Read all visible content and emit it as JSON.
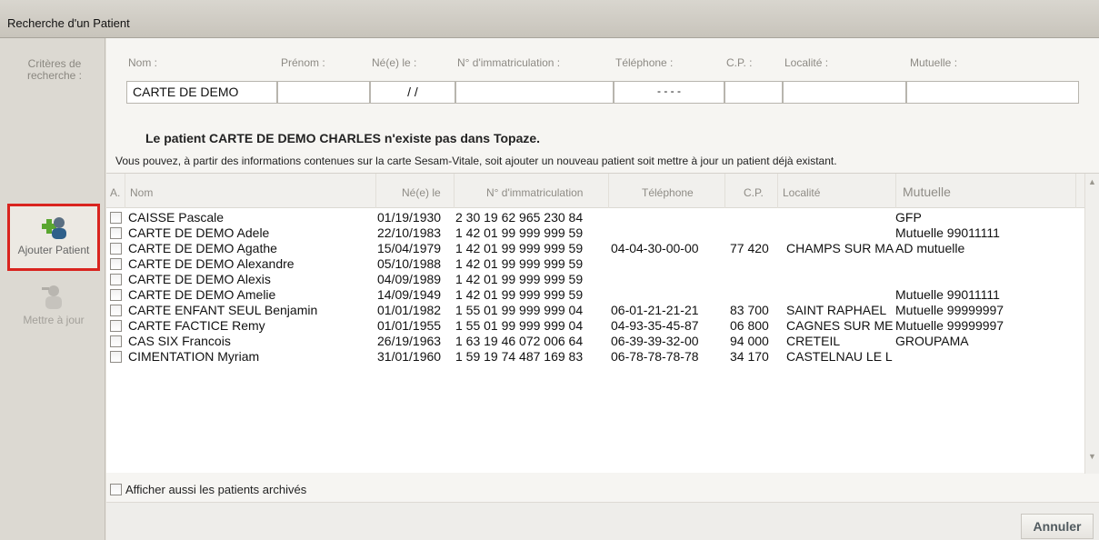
{
  "window": {
    "title": "Recherche d'un Patient"
  },
  "sidebar": {
    "criteria_label": "Critères de recherche :",
    "add_button": "Ajouter Patient",
    "update_button": "Mettre à jour"
  },
  "criteria": {
    "headers": {
      "nom": "Nom :",
      "prenom": "Prénom :",
      "ne_le": "Né(e) le :",
      "immat": "N° d'immatriculation :",
      "telephone": "Téléphone :",
      "cp": "C.P. :",
      "localite": "Localité :",
      "mutuelle": "Mutuelle :"
    },
    "values": {
      "nom": "CARTE DE DEMO",
      "prenom": "",
      "ne_le": "/ /",
      "immat": "",
      "telephone": "- - - -",
      "cp": "",
      "localite": "",
      "mutuelle": ""
    }
  },
  "message": {
    "title": "Le patient CARTE DE DEMO CHARLES n'existe pas dans Topaze.",
    "subtitle": "Vous pouvez, à partir des informations contenues sur la carte Sesam-Vitale, soit ajouter un nouveau patient soit mettre à jour un patient déjà existant."
  },
  "table": {
    "columns": {
      "a": "A.",
      "nom": "Nom",
      "ne_le": "Né(e) le",
      "immat": "N° d'immatriculation",
      "telephone": "Téléphone",
      "cp": "C.P.",
      "localite": "Localité",
      "mutuelle": "Mutuelle"
    },
    "rows": [
      {
        "nom": "CAISSE Pascale",
        "ne_le": "01/19/1930",
        "immat": "2 30 19 62 965 230 84",
        "telephone": "",
        "cp": "",
        "localite": "",
        "mutuelle": "GFP"
      },
      {
        "nom": "CARTE DE DEMO Adele",
        "ne_le": "22/10/1983",
        "immat": "1 42 01 99 999 999 59",
        "telephone": "",
        "cp": "",
        "localite": "",
        "mutuelle": "Mutuelle 99011111"
      },
      {
        "nom": "CARTE DE DEMO Agathe",
        "ne_le": "15/04/1979",
        "immat": "1 42 01 99 999 999 59",
        "telephone": "04-04-30-00-00",
        "cp": "77 420",
        "localite": "CHAMPS SUR MA",
        "mutuelle": "AD mutuelle"
      },
      {
        "nom": "CARTE DE DEMO Alexandre",
        "ne_le": "05/10/1988",
        "immat": "1 42 01 99 999 999 59",
        "telephone": "",
        "cp": "",
        "localite": "",
        "mutuelle": ""
      },
      {
        "nom": "CARTE DE DEMO Alexis",
        "ne_le": "04/09/1989",
        "immat": "1 42 01 99 999 999 59",
        "telephone": "",
        "cp": "",
        "localite": "",
        "mutuelle": ""
      },
      {
        "nom": "CARTE DE DEMO Amelie",
        "ne_le": "14/09/1949",
        "immat": "1 42 01 99 999 999 59",
        "telephone": "",
        "cp": "",
        "localite": "",
        "mutuelle": "Mutuelle 99011111"
      },
      {
        "nom": "CARTE ENFANT SEUL Benjamin",
        "ne_le": "01/01/1982",
        "immat": "1 55 01 99 999 999 04",
        "telephone": "06-01-21-21-21",
        "cp": "83 700",
        "localite": "SAINT RAPHAEL",
        "mutuelle": "Mutuelle 99999997"
      },
      {
        "nom": "CARTE FACTICE Remy",
        "ne_le": "01/01/1955",
        "immat": "1 55 01 99 999 999 04",
        "telephone": "04-93-35-45-87",
        "cp": "06 800",
        "localite": "CAGNES SUR ME",
        "mutuelle": "Mutuelle 99999997"
      },
      {
        "nom": "CAS SIX Francois",
        "ne_le": "26/19/1963",
        "immat": "1 63 19 46 072 006 64",
        "telephone": "06-39-39-32-00",
        "cp": "94 000",
        "localite": "CRETEIL",
        "mutuelle": "GROUPAMA"
      },
      {
        "nom": "CIMENTATION Myriam",
        "ne_le": "31/01/1960",
        "immat": "1 59 19 74 487 169 83",
        "telephone": "06-78-78-78-78",
        "cp": "34 170",
        "localite": "CASTELNAU LE L",
        "mutuelle": ""
      }
    ]
  },
  "footer": {
    "archive_label": "Afficher aussi les patients archivés",
    "cancel_button": "Annuler"
  }
}
